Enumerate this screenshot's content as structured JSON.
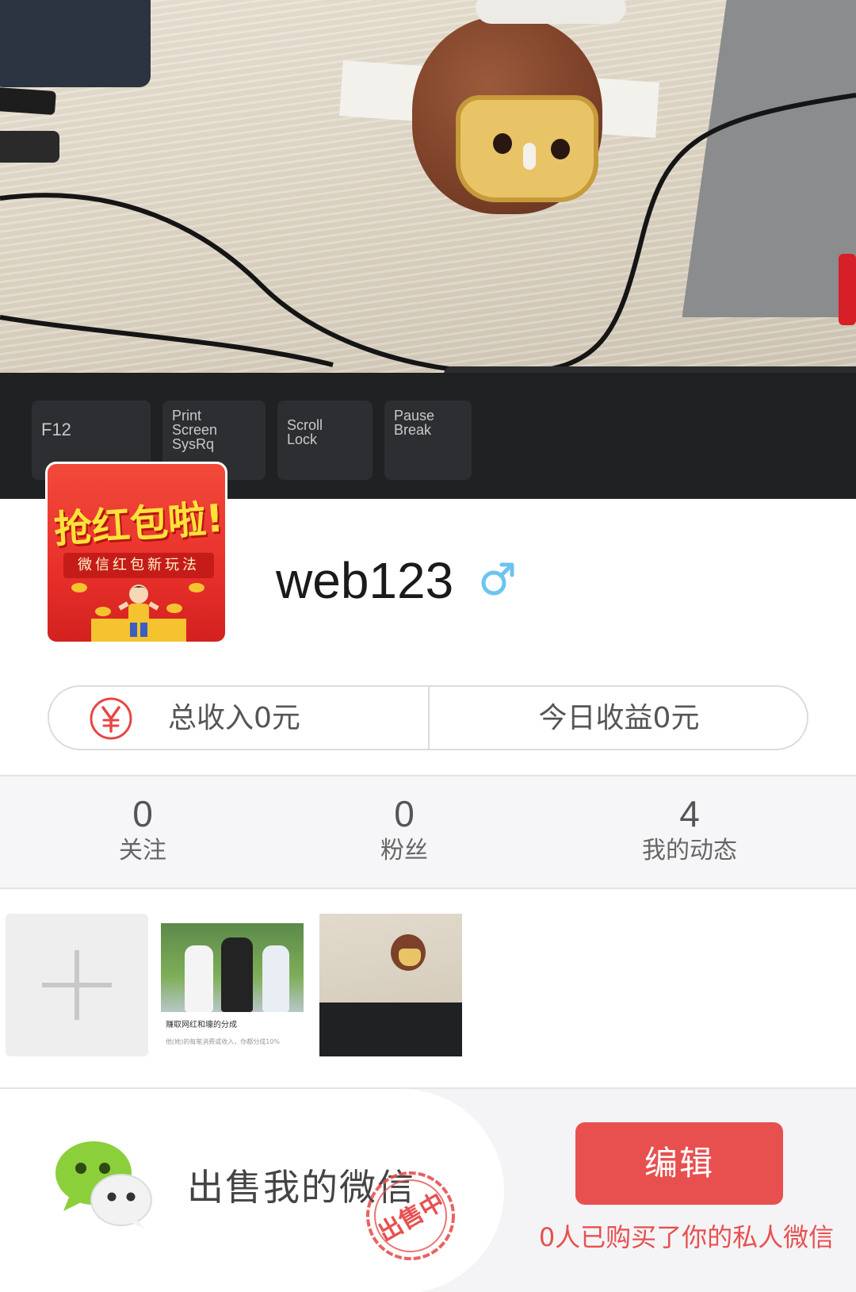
{
  "cover": {
    "keys": [
      "F12",
      "Print\nScreen\nSysRq",
      "Scroll\nLock",
      "Pause\nBreak"
    ]
  },
  "profile": {
    "avatar_title": "抢红包啦!",
    "avatar_subtitle": "微信红包新玩法",
    "username": "web123",
    "gender_icon": "male-symbol-icon"
  },
  "income": {
    "icon": "yen-circle-icon",
    "total_label": "总收入0元",
    "today_label": "今日收益0元"
  },
  "stats": [
    {
      "value": "0",
      "label": "关注"
    },
    {
      "value": "0",
      "label": "粉丝"
    },
    {
      "value": "4",
      "label": "我的动态"
    }
  ],
  "gallery": {
    "add_icon": "plus-icon",
    "thumbnails": [
      {
        "caption": "赚取网红和壕的分成",
        "subcaption": "他(她)的每笔消费或收入，你都分成10%"
      },
      {
        "caption": ""
      }
    ]
  },
  "sell": {
    "icon": "wechat-icon",
    "label": "出售我的微信",
    "stamp_text": "出售中",
    "edit_label": "编辑",
    "bought_text": "0人已购买了你的私人微信"
  },
  "colors": {
    "accent": "#e85050",
    "gender_blue": "#6cc4f0",
    "yen_red": "#e64646"
  }
}
